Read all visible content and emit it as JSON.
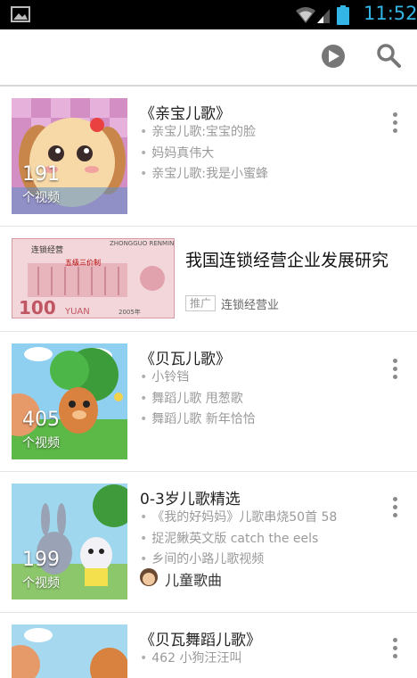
{
  "status": {
    "time": "11:52"
  },
  "items": [
    {
      "title": "《亲宝儿歌》",
      "count": "191",
      "unit": "个视频",
      "subs": [
        "亲宝儿歌:宝宝的脸",
        "妈妈真伟大",
        "亲宝儿歌:我是小蜜蜂"
      ]
    },
    {
      "ad_title": "我国连锁经营企业发展研究",
      "ad_tag": "推广",
      "ad_source": "连锁经营业",
      "banknote_text": [
        "ZHONGGUO RENMIN",
        "100",
        "YUAN",
        "五级三价制",
        "连锁经营",
        "2005年"
      ]
    },
    {
      "title": "《贝瓦儿歌》",
      "count": "405",
      "unit": "个视频",
      "subs": [
        "小铃铛",
        "舞蹈儿歌 甩葱歌",
        "舞蹈儿歌 新年恰恰"
      ]
    },
    {
      "title": "0-3岁儿歌精选",
      "count": "199",
      "unit": "个视频",
      "subs": [
        "《我的好妈妈》儿歌串烧50首 58",
        "捉泥鳅英文版 catch the eels",
        "乡间的小路儿歌视频"
      ],
      "channel": "儿童歌曲"
    },
    {
      "title": "《贝瓦舞蹈儿歌》",
      "subs": [
        "462 小狗汪汪叫"
      ]
    }
  ],
  "colors": {
    "accent": "#33b5e5",
    "icon": "#777777"
  }
}
